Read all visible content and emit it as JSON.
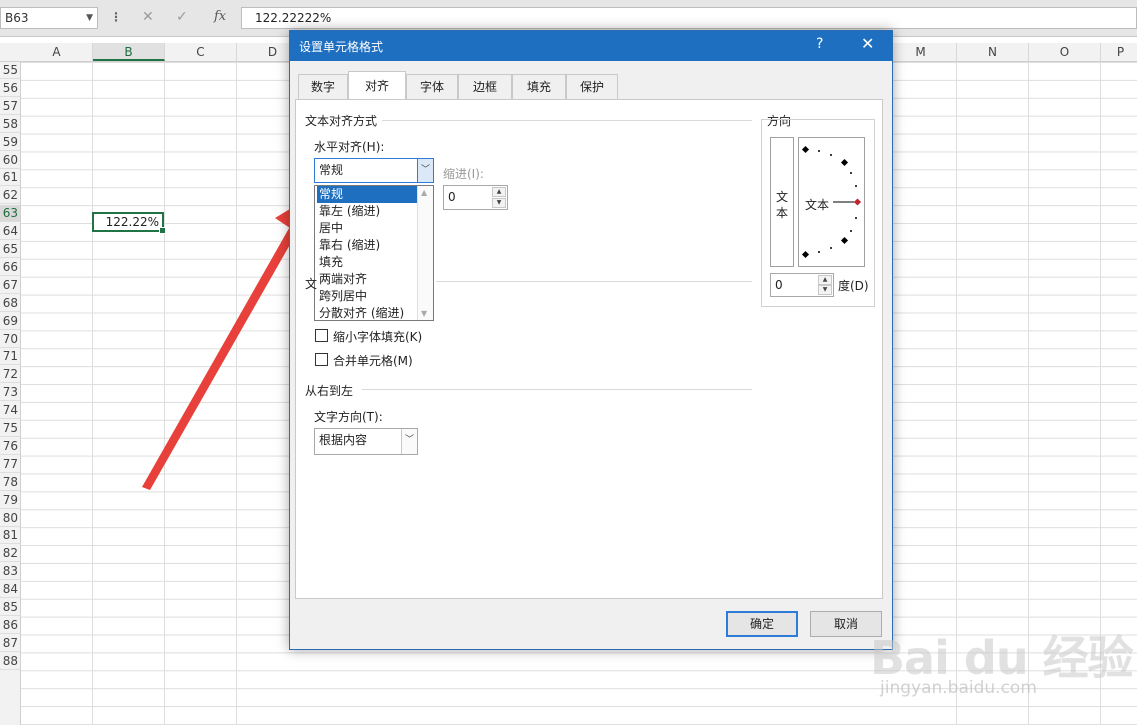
{
  "formula_bar": {
    "name_box": "B63",
    "formula_value": "122.22222%",
    "cancel_icon": "✕",
    "enter_icon": "✓",
    "fx_icon": "fx"
  },
  "sheet": {
    "columns": [
      "A",
      "B",
      "C",
      "D",
      "",
      "",
      "",
      "",
      "",
      "M",
      "N",
      "O",
      "P"
    ],
    "rows": [
      "55",
      "56",
      "57",
      "58",
      "59",
      "60",
      "61",
      "62",
      "63",
      "64",
      "65",
      "66",
      "67",
      "68",
      "69",
      "70",
      "71",
      "72",
      "73",
      "74",
      "75",
      "76",
      "77",
      "78",
      "79",
      "80",
      "81",
      "82",
      "83",
      "84",
      "85",
      "86",
      "87",
      "88"
    ],
    "selected_row": "63",
    "selected_column": "B",
    "active_cell_value": "122.22%"
  },
  "dialog": {
    "title": "设置单元格格式",
    "help": "?",
    "close": "✕",
    "tabs": [
      "数字",
      "对齐",
      "字体",
      "边框",
      "填充",
      "保护"
    ],
    "active_tab": "对齐",
    "text_alignment_section": "文本对齐方式",
    "horizontal_label": "水平对齐(H):",
    "horizontal_value": "常规",
    "horizontal_options": [
      "常规",
      "靠左 (缩进)",
      "居中",
      "靠右 (缩进)",
      "填充",
      "两端对齐",
      "跨列居中",
      "分散对齐 (缩进)"
    ],
    "indent_label": "缩进(I):",
    "indent_value": "0",
    "text_control_section_partial": "文",
    "shrink_to_fit": "缩小字体填充(K)",
    "merge_cells": "合并单元格(M)",
    "rtl_section": "从右到左",
    "text_direction_label": "文字方向(T):",
    "text_direction_value": "根据内容",
    "orientation_section": "方向",
    "vertical_text": [
      "文",
      "本"
    ],
    "dial_text": "文本",
    "degrees_value": "0",
    "degrees_label": "度(D)",
    "ok": "确定",
    "cancel": "取消"
  },
  "watermark": {
    "brand": "Bai du 经验",
    "url": "jingyan.baidu.com"
  },
  "colors": {
    "excel_green": "#217346",
    "dialog_blue": "#1f6fc1",
    "arrow_red": "#e8403a"
  }
}
